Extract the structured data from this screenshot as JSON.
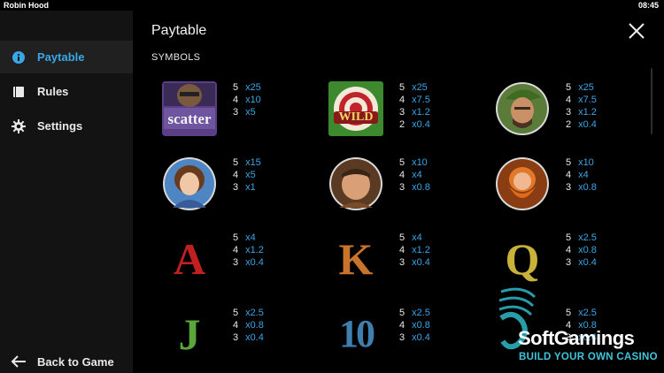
{
  "app": {
    "title": "Robin Hood",
    "time": "08:45"
  },
  "sidebar": {
    "items": [
      {
        "label": "Paytable",
        "icon": "info-icon",
        "active": true
      },
      {
        "label": "Rules",
        "icon": "book-icon",
        "active": false
      },
      {
        "label": "Settings",
        "icon": "gear-icon",
        "active": false
      }
    ],
    "back_label": "Back to Game"
  },
  "main": {
    "title": "Paytable",
    "section": "SYMBOLS"
  },
  "symbols": [
    {
      "name": "scatter",
      "label": "scatter",
      "pays": [
        [
          "5",
          "x25"
        ],
        [
          "4",
          "x10"
        ],
        [
          "3",
          "x5"
        ]
      ]
    },
    {
      "name": "wild",
      "label": "WILD",
      "pays": [
        [
          "5",
          "x25"
        ],
        [
          "4",
          "x7.5"
        ],
        [
          "3",
          "x1.2"
        ],
        [
          "2",
          "x0.4"
        ]
      ]
    },
    {
      "name": "robin-hood",
      "label": "",
      "pays": [
        [
          "5",
          "x25"
        ],
        [
          "4",
          "x7.5"
        ],
        [
          "3",
          "x1.2"
        ],
        [
          "2",
          "x0.4"
        ]
      ]
    },
    {
      "name": "maid-marian",
      "label": "",
      "pays": [
        [
          "5",
          "x15"
        ],
        [
          "4",
          "x5"
        ],
        [
          "3",
          "x1"
        ]
      ]
    },
    {
      "name": "friar-tuck",
      "label": "",
      "pays": [
        [
          "5",
          "x10"
        ],
        [
          "4",
          "x4"
        ],
        [
          "3",
          "x0.8"
        ]
      ]
    },
    {
      "name": "little-john",
      "label": "",
      "pays": [
        [
          "5",
          "x10"
        ],
        [
          "4",
          "x4"
        ],
        [
          "3",
          "x0.8"
        ]
      ]
    },
    {
      "name": "letter-a",
      "label": "A",
      "color": "#c0201f",
      "pays": [
        [
          "5",
          "x4"
        ],
        [
          "4",
          "x1.2"
        ],
        [
          "3",
          "x0.4"
        ]
      ]
    },
    {
      "name": "letter-k",
      "label": "K",
      "color": "#c8742a",
      "pays": [
        [
          "5",
          "x4"
        ],
        [
          "4",
          "x1.2"
        ],
        [
          "3",
          "x0.4"
        ]
      ]
    },
    {
      "name": "letter-q",
      "label": "Q",
      "color": "#c9b23a",
      "pays": [
        [
          "5",
          "x2.5"
        ],
        [
          "4",
          "x0.8"
        ],
        [
          "3",
          "x0.4"
        ]
      ]
    },
    {
      "name": "letter-j",
      "label": "J",
      "color": "#5aa63a",
      "pays": [
        [
          "5",
          "x2.5"
        ],
        [
          "4",
          "x0.8"
        ],
        [
          "3",
          "x0.4"
        ]
      ]
    },
    {
      "name": "number-10",
      "label": "10",
      "color": "#3f7fb0",
      "pays": [
        [
          "5",
          "x2.5"
        ],
        [
          "4",
          "x0.8"
        ],
        [
          "3",
          "x0.4"
        ]
      ]
    },
    {
      "name": "nine",
      "label": "",
      "pays": [
        [
          "5",
          "x2.5"
        ],
        [
          "4",
          "x0.8"
        ],
        [
          "3",
          "x0.4"
        ]
      ]
    }
  ],
  "watermark": {
    "name": "SoftGamings",
    "tagline": "BUILD YOUR OWN CASINO"
  },
  "colors": {
    "accent": "#3aa6e6",
    "sidebar": "#131313",
    "active": "#202020"
  }
}
